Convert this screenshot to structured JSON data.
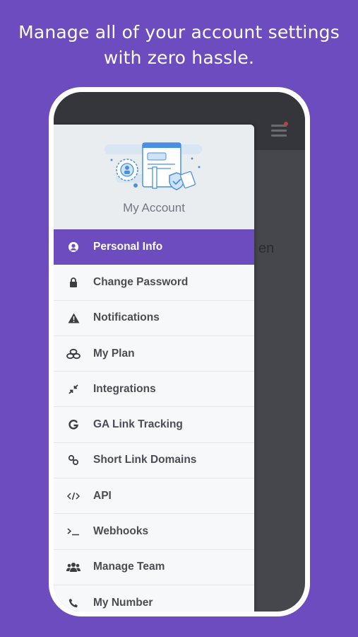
{
  "headline": {
    "line1": "Manage all of your account settings",
    "line2": "with zero hassle."
  },
  "background_app": {
    "partial_text": "en"
  },
  "drawer": {
    "title": "My Account",
    "items": [
      {
        "label": "Personal Info",
        "icon": "user-circle-icon",
        "active": true
      },
      {
        "label": "Change Password",
        "icon": "lock-icon",
        "active": false
      },
      {
        "label": "Notifications",
        "icon": "warning-triangle-icon",
        "active": false
      },
      {
        "label": "My Plan",
        "icon": "coins-icon",
        "active": false
      },
      {
        "label": "Integrations",
        "icon": "compress-arrows-icon",
        "active": false
      },
      {
        "label": "GA Link Tracking",
        "icon": "google-g-icon",
        "active": false
      },
      {
        "label": "Short Link Domains",
        "icon": "link-icon",
        "active": false
      },
      {
        "label": "API",
        "icon": "code-icon",
        "active": false
      },
      {
        "label": "Webhooks",
        "icon": "terminal-icon",
        "active": false
      },
      {
        "label": "Manage Team",
        "icon": "users-icon",
        "active": false
      },
      {
        "label": "My Number",
        "icon": "phone-icon",
        "active": false
      }
    ]
  },
  "colors": {
    "brand_purple": "#6d4cc0",
    "drawer_bg": "#f7f8fa",
    "overlay_dark": "#46474d"
  }
}
